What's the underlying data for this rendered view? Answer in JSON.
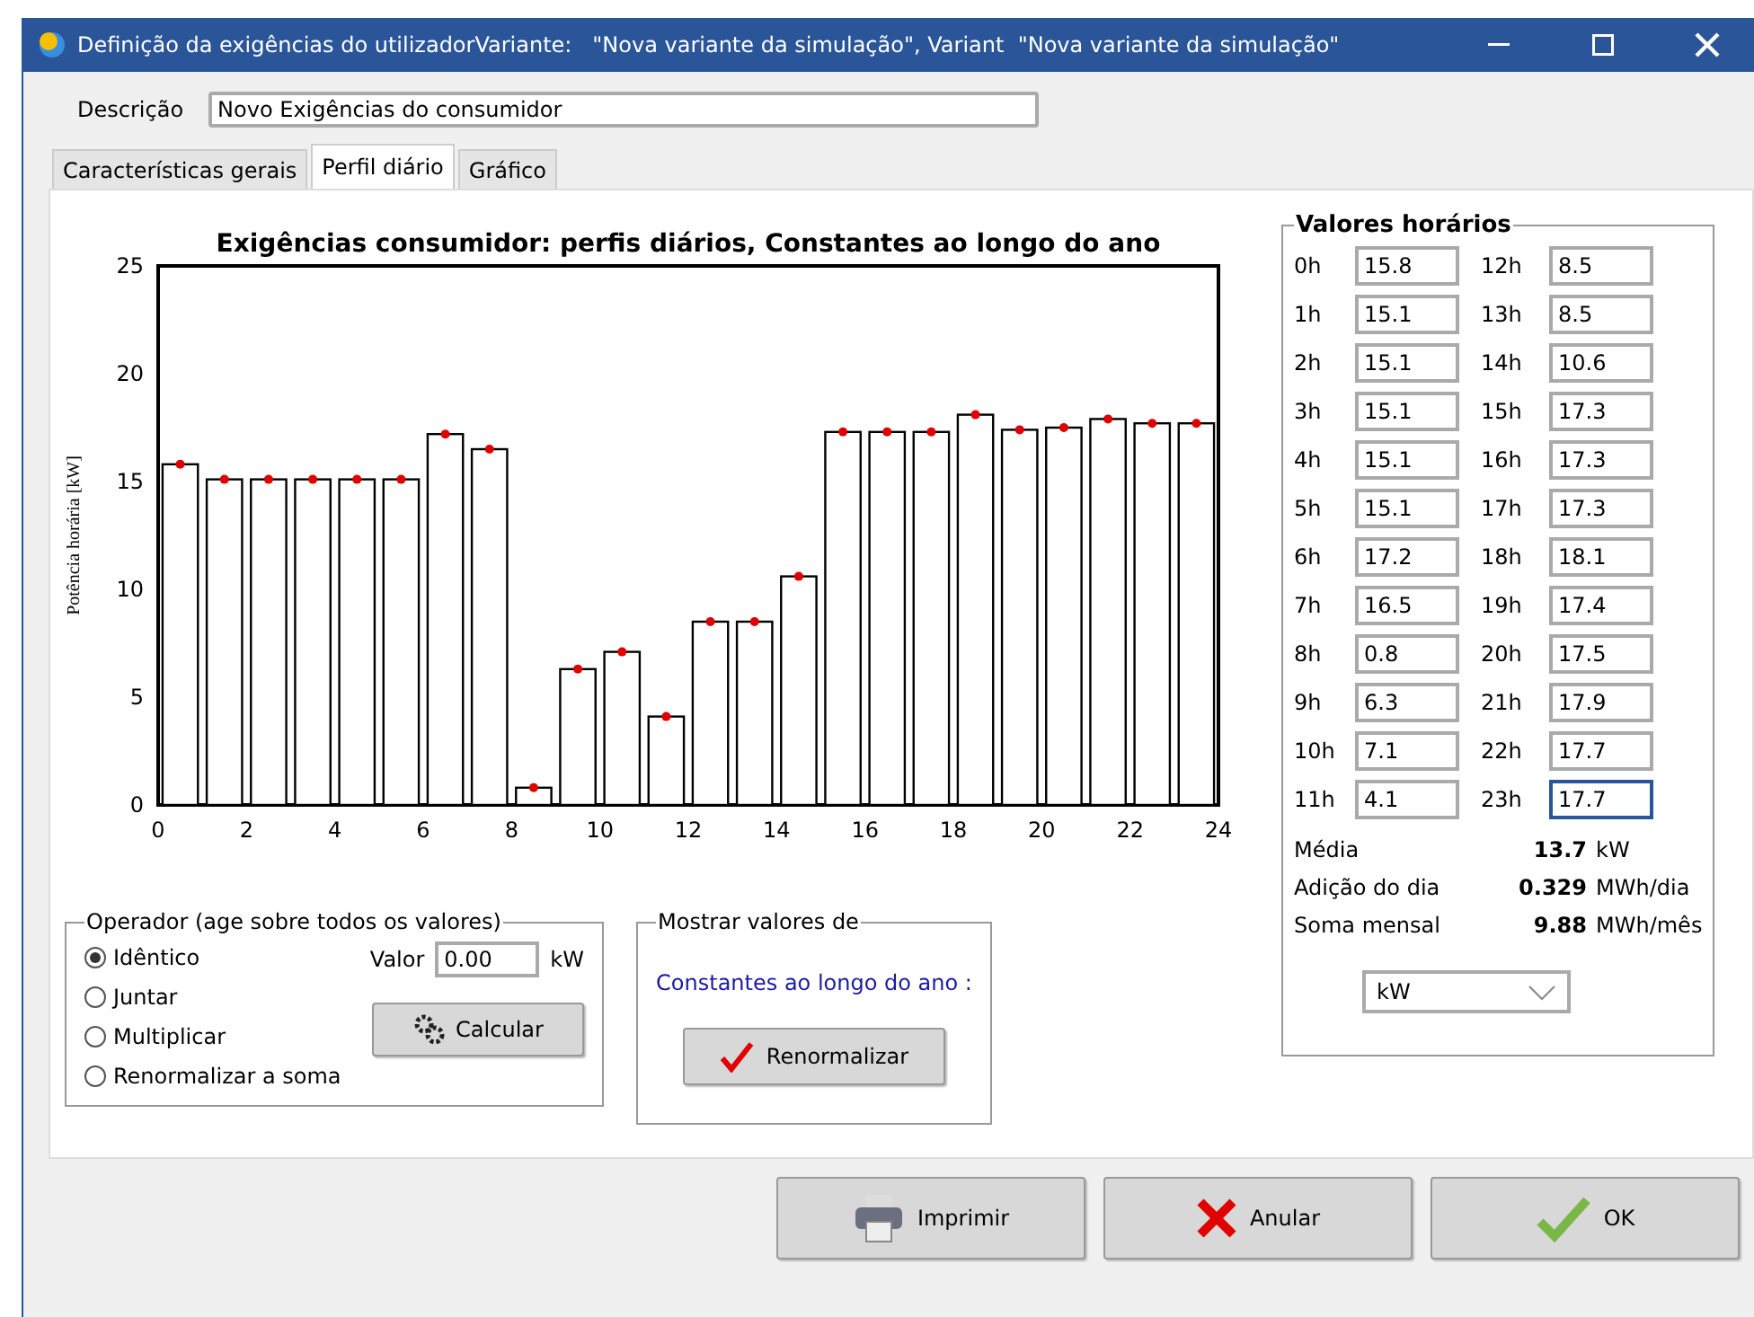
{
  "window": {
    "title": "Definição da exigências do utilizadorVariante:   \"Nova variante da simulação\", Variant  \"Nova variante da simulação\""
  },
  "description": {
    "label": "Descrição",
    "value": "Novo Exigências do consumidor"
  },
  "tabs": [
    {
      "label": "Características gerais",
      "selected": false
    },
    {
      "label": "Perfil diário",
      "selected": true
    },
    {
      "label": "Gráfico",
      "selected": false
    }
  ],
  "chart": {
    "chart_data": {
      "type": "bar",
      "title": "Exigências consumidor: perfis diários, Constantes ao longo do ano",
      "ylabel": "Potência horária [kW]",
      "x": [
        0.5,
        1.5,
        2.5,
        3.5,
        4.5,
        5.5,
        6.5,
        7.5,
        8.5,
        9.5,
        10.5,
        11.5,
        12.5,
        13.5,
        14.5,
        15.5,
        16.5,
        17.5,
        18.5,
        19.5,
        20.5,
        21.5,
        22.5,
        23.5
      ],
      "values": [
        15.8,
        15.1,
        15.1,
        15.1,
        15.1,
        15.1,
        17.2,
        16.5,
        0.8,
        6.3,
        7.1,
        4.1,
        8.5,
        8.5,
        10.6,
        17.3,
        17.3,
        17.3,
        18.1,
        17.4,
        17.5,
        17.9,
        17.7,
        17.7
      ],
      "xlim": [
        0,
        24
      ],
      "ylim": [
        0,
        25
      ],
      "xticks": [
        0,
        2,
        4,
        6,
        8,
        10,
        12,
        14,
        16,
        18,
        20,
        22,
        24
      ],
      "yticks": [
        0,
        5,
        10,
        15,
        20,
        25
      ]
    }
  },
  "hourly": {
    "title": "Valores horários",
    "values": [
      {
        "label": "0h",
        "value": "15.8",
        "focused": false
      },
      {
        "label": "1h",
        "value": "15.1",
        "focused": false
      },
      {
        "label": "2h",
        "value": "15.1",
        "focused": false
      },
      {
        "label": "3h",
        "value": "15.1",
        "focused": false
      },
      {
        "label": "4h",
        "value": "15.1",
        "focused": false
      },
      {
        "label": "5h",
        "value": "15.1",
        "focused": false
      },
      {
        "label": "6h",
        "value": "17.2",
        "focused": false
      },
      {
        "label": "7h",
        "value": "16.5",
        "focused": false
      },
      {
        "label": "8h",
        "value": "0.8",
        "focused": false
      },
      {
        "label": "9h",
        "value": "6.3",
        "focused": false
      },
      {
        "label": "10h",
        "value": "7.1",
        "focused": false
      },
      {
        "label": "11h",
        "value": "4.1",
        "focused": false
      },
      {
        "label": "12h",
        "value": "8.5",
        "focused": false
      },
      {
        "label": "13h",
        "value": "8.5",
        "focused": false
      },
      {
        "label": "14h",
        "value": "10.6",
        "focused": false
      },
      {
        "label": "15h",
        "value": "17.3",
        "focused": false
      },
      {
        "label": "16h",
        "value": "17.3",
        "focused": false
      },
      {
        "label": "17h",
        "value": "17.3",
        "focused": false
      },
      {
        "label": "18h",
        "value": "18.1",
        "focused": false
      },
      {
        "label": "19h",
        "value": "17.4",
        "focused": false
      },
      {
        "label": "20h",
        "value": "17.5",
        "focused": false
      },
      {
        "label": "21h",
        "value": "17.9",
        "focused": false
      },
      {
        "label": "22h",
        "value": "17.7",
        "focused": false
      },
      {
        "label": "23h",
        "value": "17.7",
        "focused": true
      }
    ],
    "stats": [
      {
        "label": "Média",
        "value": "13.7",
        "unit": "kW"
      },
      {
        "label": "Adição do dia",
        "value": "0.329",
        "unit": "MWh/dia"
      },
      {
        "label": "Soma mensal",
        "value": "9.88",
        "unit": "MWh/mês"
      }
    ],
    "unit_select": "kW"
  },
  "operator": {
    "title": "Operador (age sobre todos os valores)",
    "options": [
      {
        "label": "Idêntico",
        "selected": true
      },
      {
        "label": "Juntar",
        "selected": false
      },
      {
        "label": "Multiplicar",
        "selected": false
      },
      {
        "label": "Renormalizar a soma",
        "selected": false
      }
    ],
    "value_label": "Valor",
    "value": "0.00",
    "unit": "kW",
    "button": "Calcular"
  },
  "show_values": {
    "title": "Mostrar valores de",
    "text": "Constantes ao longo do ano :",
    "button": "Renormalizar"
  },
  "buttons": [
    {
      "kind": "print",
      "label": "Imprimir"
    },
    {
      "kind": "cancel",
      "label": "Anular"
    },
    {
      "kind": "ok",
      "label": "OK"
    }
  ]
}
